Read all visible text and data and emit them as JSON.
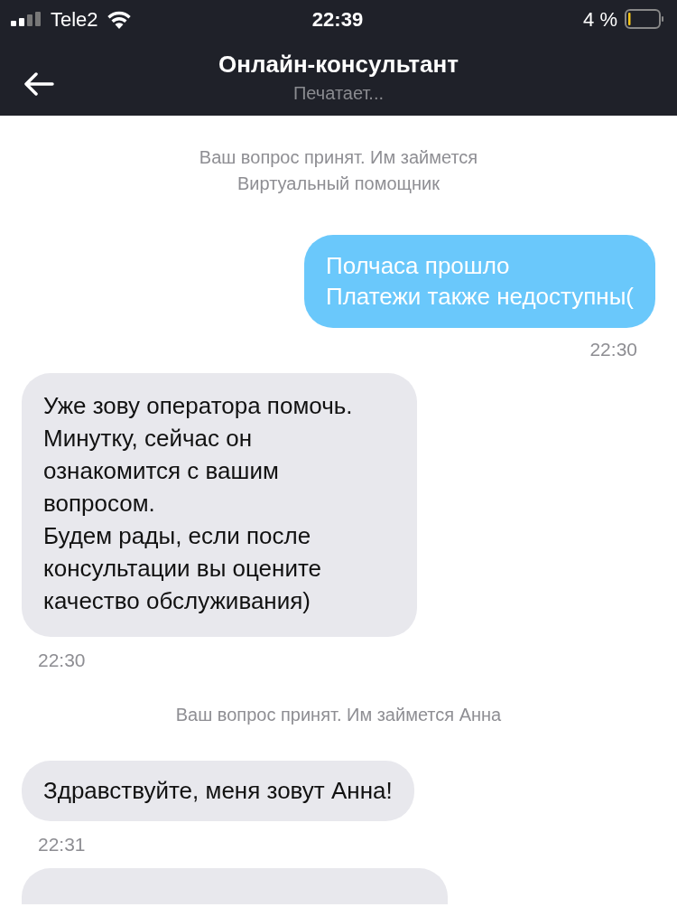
{
  "status_bar": {
    "carrier": "Tele2",
    "time": "22:39",
    "battery": "4 %"
  },
  "header": {
    "title": "Онлайн-консультант",
    "subtitle": "Печатает..."
  },
  "messages": [
    {
      "kind": "notice",
      "text": "Ваш вопрос принят. Им займется\nВиртуальный помощник"
    },
    {
      "kind": "outgoing",
      "text": "Полчаса прошло\nПлатежи также недоступны(",
      "time": "22:30"
    },
    {
      "kind": "incoming",
      "text": "Уже зову оператора помочь.\nМинутку, сейчас он ознакомится с вашим вопросом.\nБудем рады, если после консультации вы оцените качество обслуживания)",
      "time": "22:30"
    },
    {
      "kind": "notice",
      "text": "Ваш вопрос принят. Им займется Анна"
    },
    {
      "kind": "incoming",
      "text": "Здравствуйте, меня зовут Анна!",
      "time": "22:31"
    },
    {
      "kind": "partial"
    }
  ]
}
